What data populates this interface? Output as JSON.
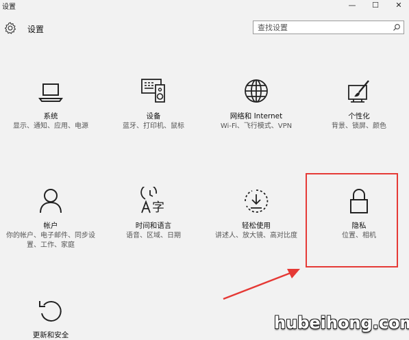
{
  "window": {
    "title": "设置",
    "minimize": "—",
    "maximize": "☐",
    "close": "✕"
  },
  "header": {
    "title": "设置",
    "search_placeholder": "查找设置"
  },
  "tiles": [
    {
      "label": "系统",
      "desc": "显示、通知、应用、电源",
      "icon": "laptop-icon"
    },
    {
      "label": "设备",
      "desc": "蓝牙、打印机、鼠标",
      "icon": "devices-icon"
    },
    {
      "label": "网络和 Internet",
      "desc": "Wi-Fi、飞行模式、VPN",
      "icon": "globe-icon"
    },
    {
      "label": "个性化",
      "desc": "背景、锁屏、颜色",
      "icon": "paintbrush-icon"
    },
    {
      "label": "帐户",
      "desc": "你的帐户、电子邮件、同步设置、工作、家庭",
      "icon": "person-icon"
    },
    {
      "label": "时间和语言",
      "desc": "语音、区域、日期",
      "icon": "time-language-icon"
    },
    {
      "label": "轻松使用",
      "desc": "讲述人、放大镜、高对比度",
      "icon": "ease-of-access-icon"
    },
    {
      "label": "隐私",
      "desc": "位置、相机",
      "icon": "lock-icon"
    },
    {
      "label": "更新和安全",
      "desc": "",
      "icon": "update-icon"
    }
  ],
  "annotation": {
    "highlight_color": "#e53935"
  },
  "watermark": "hubeihong.com"
}
